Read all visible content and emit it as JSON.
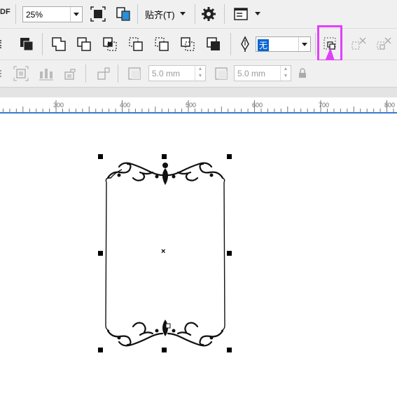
{
  "toolbar1": {
    "pdf_label": "DF",
    "zoom_value": "25%",
    "snap_label": "贴齐(T)"
  },
  "toolbar2": {
    "outline_value": "无"
  },
  "toolbar3": {
    "width_value": "5.0 mm",
    "height_value": "5.0 mm"
  },
  "ruler": {
    "labels": [
      "300",
      "400",
      "500",
      "600",
      "700",
      "800"
    ]
  },
  "colors": {
    "highlight": "#e040fb",
    "ruler_line": "#3a7bd5",
    "toolbar_bg": "#f0f0f0"
  },
  "icons": {
    "zoom_fit": "fit-page-icon",
    "full_screen": "full-screen-icon",
    "settings": "gear-icon",
    "options": "options-window-icon",
    "highlighted_tool": "create-boundary-icon"
  }
}
